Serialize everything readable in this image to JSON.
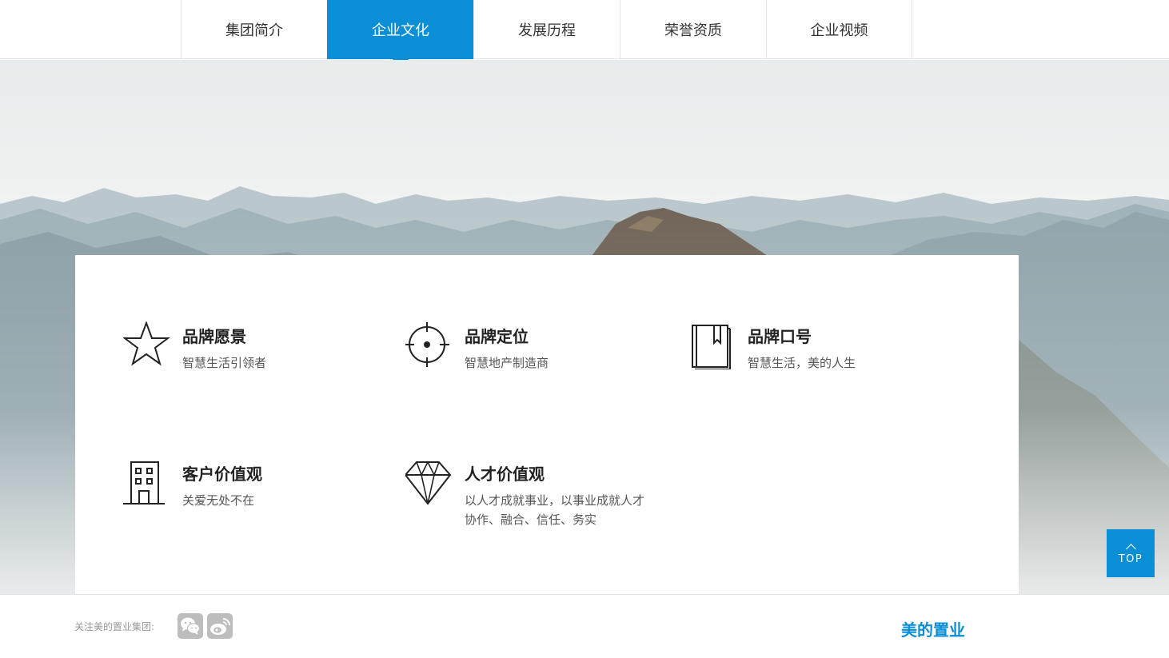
{
  "nav": {
    "tabs": [
      {
        "label": "集团简介"
      },
      {
        "label": "企业文化"
      },
      {
        "label": "发展历程"
      },
      {
        "label": "荣誉资质"
      },
      {
        "label": "企业视频"
      }
    ],
    "active_index": 1
  },
  "culture": {
    "items": [
      {
        "icon": "star-icon",
        "title": "品牌愿景",
        "desc": [
          "智慧生活引领者"
        ]
      },
      {
        "icon": "crosshair-icon",
        "title": "品牌定位",
        "desc": [
          "智慧地产制造商"
        ]
      },
      {
        "icon": "book-icon",
        "title": "品牌口号",
        "desc": [
          "智慧生活，美的人生"
        ]
      },
      {
        "icon": "building-icon",
        "title": "客户价值观",
        "desc": [
          "关爱无处不在"
        ]
      },
      {
        "icon": "diamond-icon",
        "title": "人才价值观",
        "desc": [
          "以人才成就事业，以事业成就人才",
          "协作、融合、信任、务实"
        ]
      }
    ]
  },
  "back_to_top": {
    "label": "TOP"
  },
  "footer": {
    "follow_label": "关注美的置业集团:",
    "social": [
      {
        "icon": "wechat-icon"
      },
      {
        "icon": "weibo-icon"
      }
    ],
    "brand_name": "美的置业"
  },
  "colors": {
    "accent": "#0a8fd6",
    "icon_gray": "#bdbdbd"
  }
}
